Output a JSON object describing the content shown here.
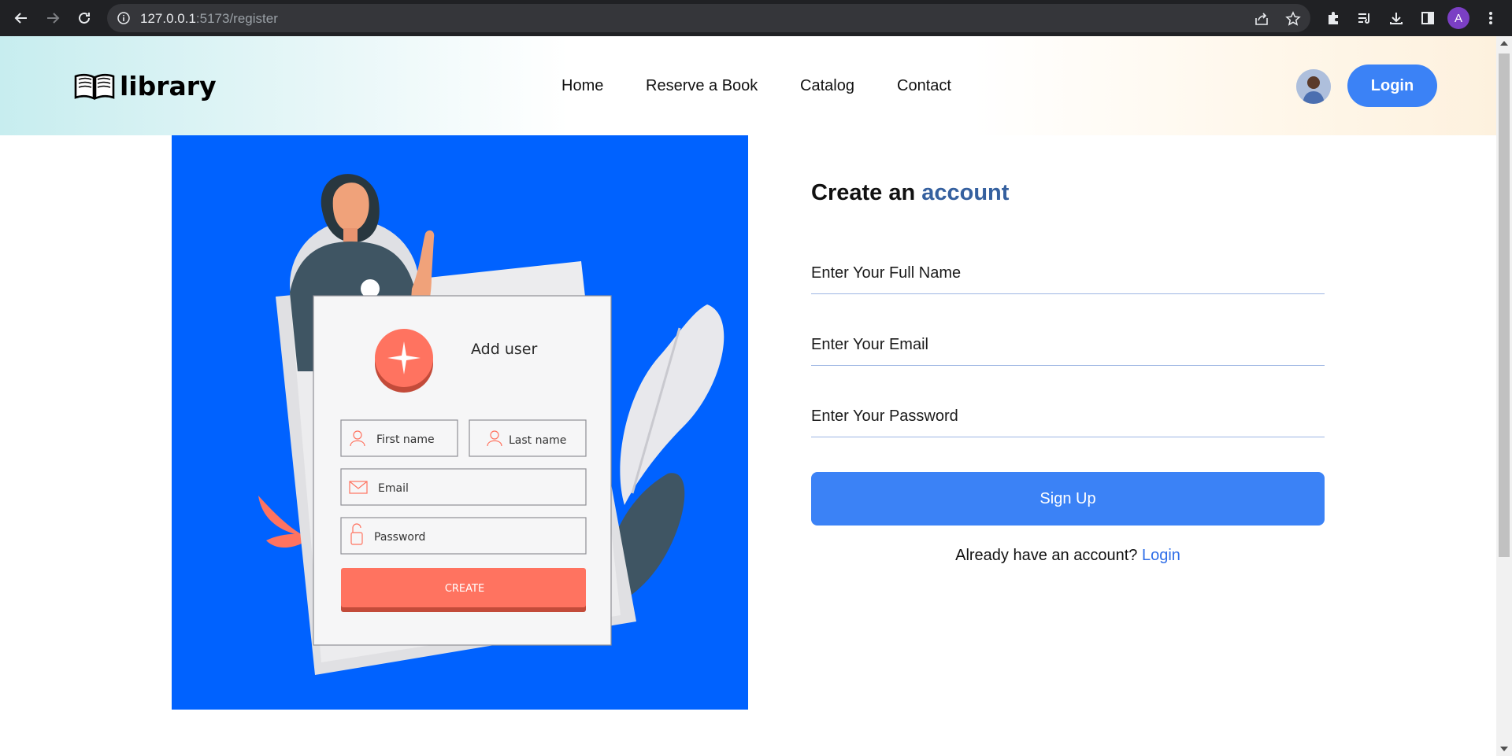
{
  "browser": {
    "url_host": "127.0.0.1",
    "url_path": ":5173/register",
    "profile_initial": "A"
  },
  "header": {
    "logo_text": "library",
    "nav": [
      "Home",
      "Reserve a Book",
      "Catalog",
      "Contact"
    ],
    "login_label": "Login"
  },
  "illustration": {
    "card_title": "Add user",
    "first_name": "First name",
    "last_name": "Last name",
    "email": "Email",
    "password": "Password",
    "create": "CREATE"
  },
  "form": {
    "title_main": "Create an",
    "title_accent": "account",
    "full_name_placeholder": "Enter Your Full Name",
    "email_placeholder": "Enter Your Email",
    "password_placeholder": "Enter Your Password",
    "signup_label": "Sign Up",
    "already_text": "Already have an account?",
    "login_link": "Login"
  },
  "colors": {
    "primary": "#3b82f6",
    "illustration_bg": "#0062ff",
    "accent_title": "#35609f",
    "coral": "#ff7360"
  }
}
